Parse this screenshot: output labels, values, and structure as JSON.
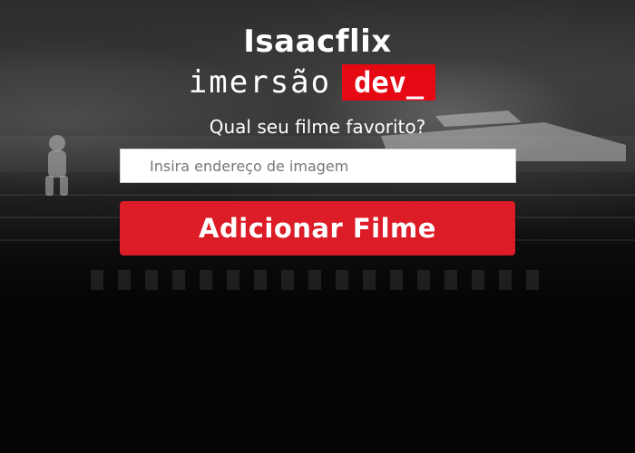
{
  "header": {
    "brand": "Isaacflix",
    "subtitle": "imersão",
    "badge": "dev_"
  },
  "form": {
    "question": "Qual seu filme favorito?",
    "input_value": "",
    "input_placeholder": "Insira endereço de imagem",
    "add_button_label": "Adicionar Filme"
  },
  "colors": {
    "accent": "#e50914",
    "button": "#dc1c27",
    "background": "#050505"
  }
}
